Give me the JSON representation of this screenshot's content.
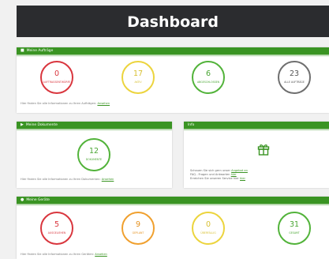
{
  "header": {
    "title": "Dashboard"
  },
  "orders": {
    "title": "Meine Aufträge",
    "stats": [
      {
        "value": "0",
        "label": "Auftragsentwürfe"
      },
      {
        "value": "17",
        "label": "Aktiv"
      },
      {
        "value": "6",
        "label": "Abgeschlossen"
      },
      {
        "value": "23",
        "label": "Alle Aufträge"
      }
    ],
    "footer": "Hier finden Sie alle Informationen zu Ihren Aufträgen:",
    "footer_link": "Ansehen"
  },
  "documents": {
    "title": "Meine Dokumente",
    "stats": [
      {
        "value": "12",
        "label": "Dokumente"
      }
    ],
    "footer": "Hier finden Sie alle Informationen zu Ihren Dokumenten:",
    "footer_link": "Ansehen"
  },
  "info": {
    "title": "Info",
    "line1": "Schauen Sie sich gern unser",
    "line1_link": "Angebot an",
    "line2": "FAQ - Fragen und Antworten",
    "line2_link": "hier",
    "line3": "Erreichen Sie unseren Service hier",
    "line3_link": "hier"
  },
  "devices": {
    "title": "Meine Geräte",
    "stats": [
      {
        "value": "5",
        "label": "Ausgeliehen"
      },
      {
        "value": "9",
        "label": "Geplant"
      },
      {
        "value": "0",
        "label": "Überfällig"
      },
      {
        "value": "31",
        "label": "Gesamt"
      }
    ],
    "footer": "Hier finden Sie alle Informationen zu Ihren Geräten:",
    "footer_link": "Ansehen"
  },
  "colors": {
    "header_bg": "#2b2c2f",
    "accent_green": "#3a9423",
    "red": "#d9363e",
    "yellow": "#ecd43d",
    "green": "#52b33a",
    "gray": "#6f6f6f",
    "orange": "#f0a02e"
  }
}
